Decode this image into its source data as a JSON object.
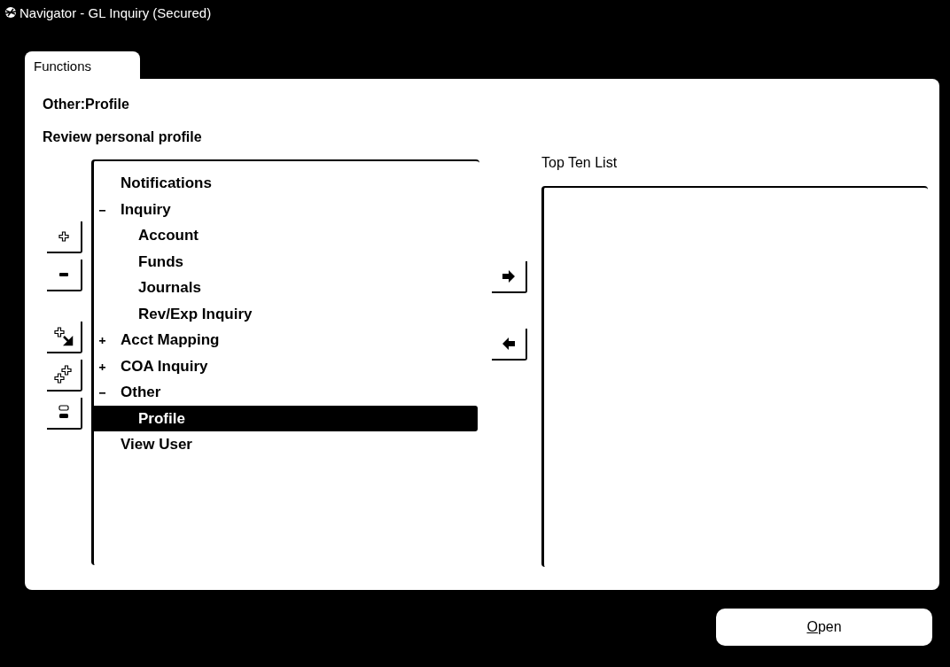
{
  "window": {
    "title": "Navigator - GL Inquiry (Secured)"
  },
  "tabs": [
    {
      "label": "Functions",
      "selected": true
    }
  ],
  "path": "Other:Profile",
  "description": "Review personal profile",
  "tree": [
    {
      "label": "Notifications",
      "selected": false
    },
    {
      "label": "Inquiry",
      "expanded": true,
      "selected": false,
      "children": [
        {
          "label": "Account",
          "selected": false
        },
        {
          "label": "Funds",
          "selected": false
        },
        {
          "label": "Journals",
          "selected": false
        },
        {
          "label": "Rev/Exp Inquiry",
          "selected": false
        }
      ]
    },
    {
      "label": "Acct Mapping",
      "expanded": false,
      "selected": false
    },
    {
      "label": "COA Inquiry",
      "expanded": false,
      "selected": false
    },
    {
      "label": "Other",
      "expanded": true,
      "selected": false,
      "children": [
        {
          "label": "Profile",
          "selected": true
        }
      ]
    },
    {
      "label": "View User",
      "selected": false
    }
  ],
  "top_ten": {
    "label": "Top Ten List"
  },
  "open_button": {
    "label": "Open"
  }
}
